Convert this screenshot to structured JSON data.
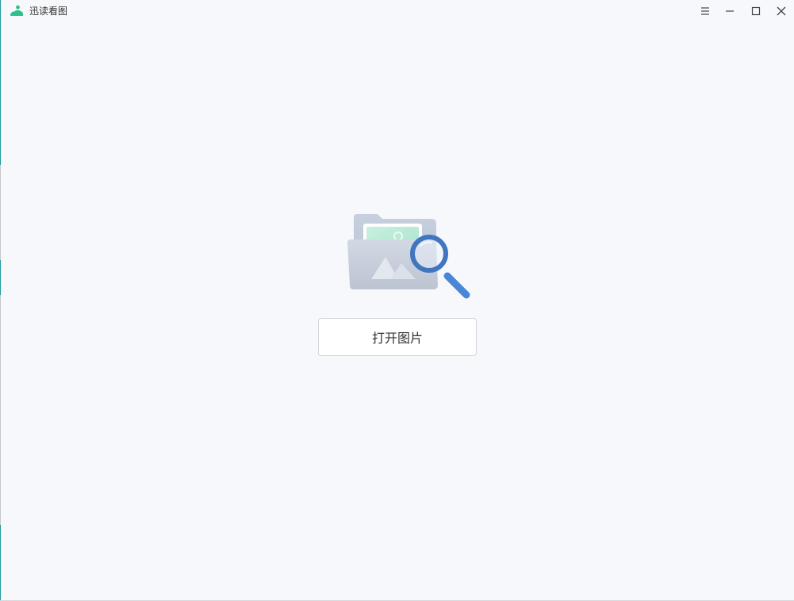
{
  "app": {
    "title": "迅读看图",
    "logo_icon": "app-logo-icon",
    "brand_color": "#2cc08a"
  },
  "window_controls": {
    "menu_icon": "menu-icon",
    "minimize_icon": "minimize-icon",
    "maximize_icon": "maximize-icon",
    "close_icon": "close-icon"
  },
  "empty_state": {
    "illustration_icon": "folder-image-magnifier-icon",
    "open_button_label": "打开图片"
  },
  "colors": {
    "background": "#f7f8fc",
    "button_border": "#d2d5dc",
    "magnifier": "#4a86d8"
  }
}
